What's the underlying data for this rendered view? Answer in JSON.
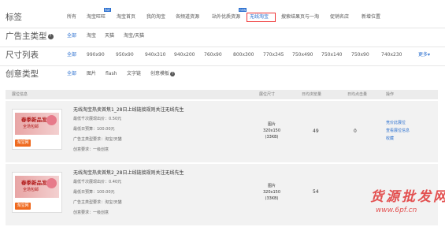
{
  "filters": {
    "tag_row": {
      "label": "标签",
      "options": [
        "所有",
        "淘宝旺旺",
        "淘宝首页",
        "我的淘宝",
        "各频道资源",
        "站外优质资源",
        "无线淘宝",
        "搜索结果页与一淘",
        "促销名店",
        "新增位置"
      ],
      "selected": "无线淘宝",
      "badges": [
        {
          "text": "hot"
        },
        {
          "text": "new"
        }
      ]
    },
    "advertiser_row": {
      "label": "广告主类型",
      "help_icon": "question-icon",
      "options": [
        "全部",
        "淘宝",
        "天猫",
        "淘宝/天猫"
      ],
      "selected": "全部"
    },
    "size_row": {
      "label": "尺寸列表",
      "options": [
        "全部",
        "990x90",
        "950x90",
        "940x310",
        "940x200",
        "760x90",
        "800x300",
        "770x345",
        "750x490",
        "750x140",
        "750x90",
        "740x230"
      ],
      "selected": "全部",
      "more_label": "更多",
      "more_icon": "chevron-down-icon"
    },
    "creative_row": {
      "label": "创意类型",
      "options": [
        "全部",
        "图片",
        "flash",
        "文字链",
        "创意模板"
      ],
      "selected": "全部",
      "help_icon": "question-icon"
    }
  },
  "table": {
    "headers": [
      "展位信息",
      "展位尺寸",
      "日均浏览量",
      "日均点击量",
      "操作"
    ],
    "rows": [
      {
        "title": "无线淘宝热卖首焦1_28日上线链接规则关注无线先生",
        "min_price": "最低千次展现出价：0.50元",
        "min_budget": "最低日预算：100.00元",
        "advertiser_req": "广告主类型要求：淘宝/天猫",
        "creative_req": "创意要求：一级创意",
        "type": "图片",
        "size": "320x150",
        "filesize": "(33KB)",
        "pv": "49",
        "clicks": "0",
        "ops": [
          "竞价此展位",
          "查看展位信息",
          "收藏"
        ],
        "banner": {
          "title": "春季新品发布",
          "sub": "全场包邮",
          "logo": "淘宝网"
        }
      },
      {
        "title": "无线淘宝热卖首焦2_28日上线链接规则关注无线先生",
        "min_price": "最低千次展现出价：0.40元",
        "min_budget": "最低日预算：100.00元",
        "advertiser_req": "广告主类型要求：淘宝/天猫",
        "creative_req": "创意要求：一级创意",
        "type": "图片",
        "size": "320x150",
        "filesize": "(33KB)",
        "pv": "54",
        "clicks": "",
        "ops": [],
        "banner": {
          "title": "春季新品发布",
          "sub": "全场包邮",
          "logo": "淘宝网"
        }
      }
    ]
  },
  "watermark": {
    "line1": "货源批发网",
    "line2": "www.6pf.cn"
  },
  "colors": {
    "link": "#2a6fcf",
    "selected_border": "#ee3333",
    "watermark": "#e35050",
    "row_bg": "#f2f2f2"
  }
}
